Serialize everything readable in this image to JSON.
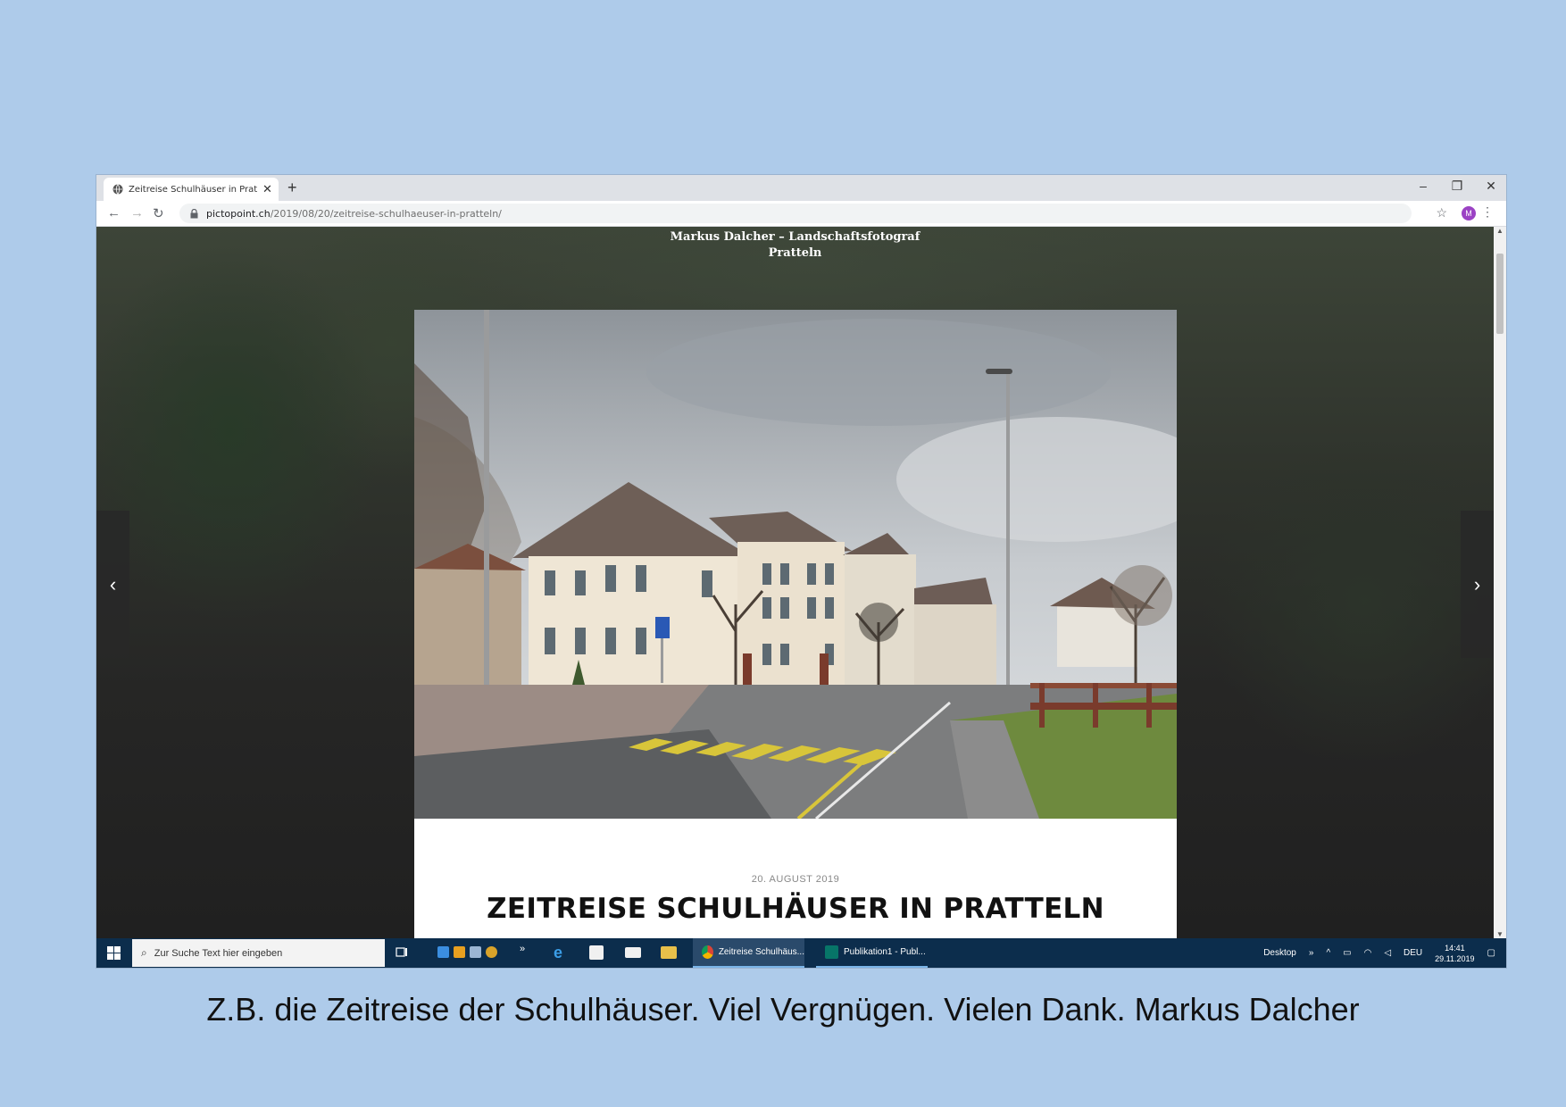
{
  "slide": {
    "background": "#aecbea",
    "caption": "Z.B. die Zeitreise der Schulhäuser.  Viel Vergnügen. Vielen Dank. Markus Dalcher"
  },
  "browser": {
    "tab": {
      "title": "Zeitreise Schulhäuser in Pratteln",
      "close": "✕",
      "favicon": "globe-icon"
    },
    "new_tab": "+",
    "window_controls": {
      "minimize": "–",
      "restore": "❐",
      "close": "✕"
    },
    "nav": {
      "back": "←",
      "forward": "→",
      "reload": "↻"
    },
    "url": {
      "host": "pictopoint.ch",
      "path": "/2019/08/20/zeitreise-schulhaeuser-in-pratteln/"
    },
    "bookmark": "☆",
    "profile_initial": "M",
    "profile_color": "#9b42c4",
    "menu": "⋮"
  },
  "page": {
    "site_title": "Markus Dalcher – Landschaftsfotograf",
    "site_subtitle": "Pratteln",
    "prev_arrow": "‹",
    "next_arrow": "›",
    "post_date": "20. AUGUST 2019",
    "post_title": "ZEITREISE SCHULHÄUSER IN PRATTELN"
  },
  "taskbar": {
    "search_placeholder": "Zur Suche Text hier eingeben",
    "overflow": "»",
    "apps": [
      {
        "label": "Zeitreise Schulhäus...",
        "icon": "chrome-icon"
      },
      {
        "label": "Publikation1 - Publ...",
        "icon": "publisher-icon"
      }
    ],
    "tray": {
      "desktop": "Desktop",
      "overflow": "»",
      "chevron": "^",
      "language": "DEU",
      "time": "14:41",
      "date": "29.11.2019"
    },
    "accent": "#0c2d4c"
  }
}
